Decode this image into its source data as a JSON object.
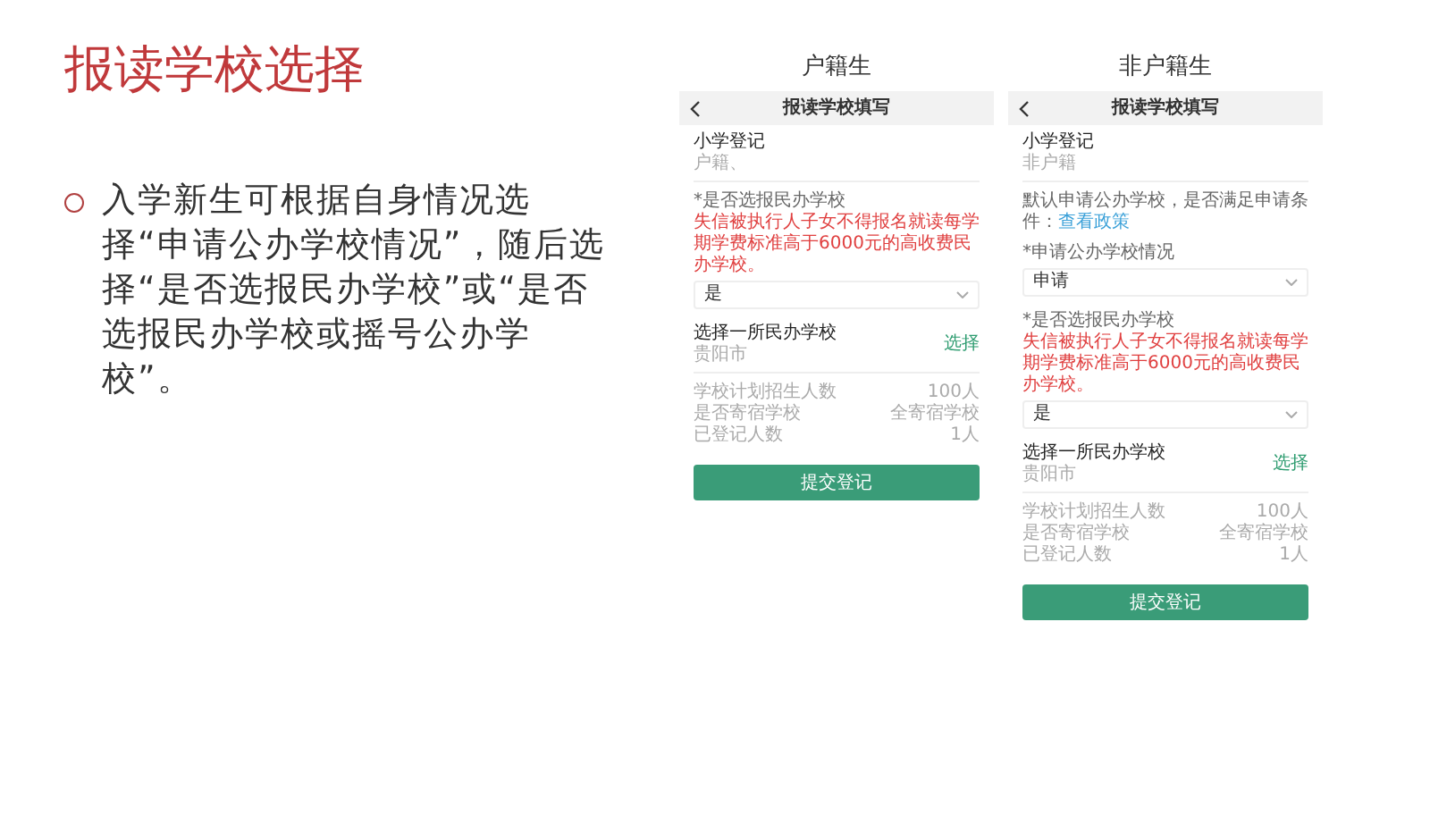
{
  "slide": {
    "title": "报读学校选择",
    "bullets": [
      "入学新生可根据自身情况选择“申请公办学校情况”，随后选择“是否选报民办学校”或“是否选报民办学校或摇号公办学校”。"
    ]
  },
  "phones": [
    {
      "caption": "户籍生",
      "header": "报读学校填写",
      "sections": [
        {
          "kind": "heading",
          "title": "小学登记",
          "subtitle": "户籍、"
        },
        {
          "kind": "field",
          "label": "*是否选报民办学校",
          "warning": "失信被执行人子女不得报名就读每学期学费标准高于6000元的高收费民办学校。",
          "value": "是"
        },
        {
          "kind": "school",
          "title": "选择一所民办学校",
          "subtitle": "贵阳市",
          "action": "选择"
        },
        {
          "kind": "info",
          "rows": [
            {
              "label": "学校计划招生人数",
              "value": "100人"
            },
            {
              "label": "是否寄宿学校",
              "value": "全寄宿学校"
            },
            {
              "label": "已登记人数",
              "value": "1人"
            }
          ]
        },
        {
          "kind": "button",
          "label": "提交登记"
        }
      ]
    },
    {
      "caption": "非户籍生",
      "header": "报读学校填写",
      "sections": [
        {
          "kind": "heading",
          "title": "小学登记",
          "subtitle": "非户籍"
        },
        {
          "kind": "notice",
          "text": "默认申请公办学校，是否满足申请条件：",
          "link": "查看政策"
        },
        {
          "kind": "field",
          "label": "*申请公办学校情况",
          "value": "申请"
        },
        {
          "kind": "field",
          "label": "*是否选报民办学校",
          "warning": "失信被执行人子女不得报名就读每学期学费标准高于6000元的高收费民办学校。",
          "value": "是"
        },
        {
          "kind": "school",
          "title": "选择一所民办学校",
          "subtitle": "贵阳市",
          "action": "选择"
        },
        {
          "kind": "info",
          "rows": [
            {
              "label": "学校计划招生人数",
              "value": "100人"
            },
            {
              "label": "是否寄宿学校",
              "value": "全寄宿学校"
            },
            {
              "label": "已登记人数",
              "value": "1人"
            }
          ]
        },
        {
          "kind": "button",
          "label": "提交登记"
        }
      ]
    }
  ]
}
